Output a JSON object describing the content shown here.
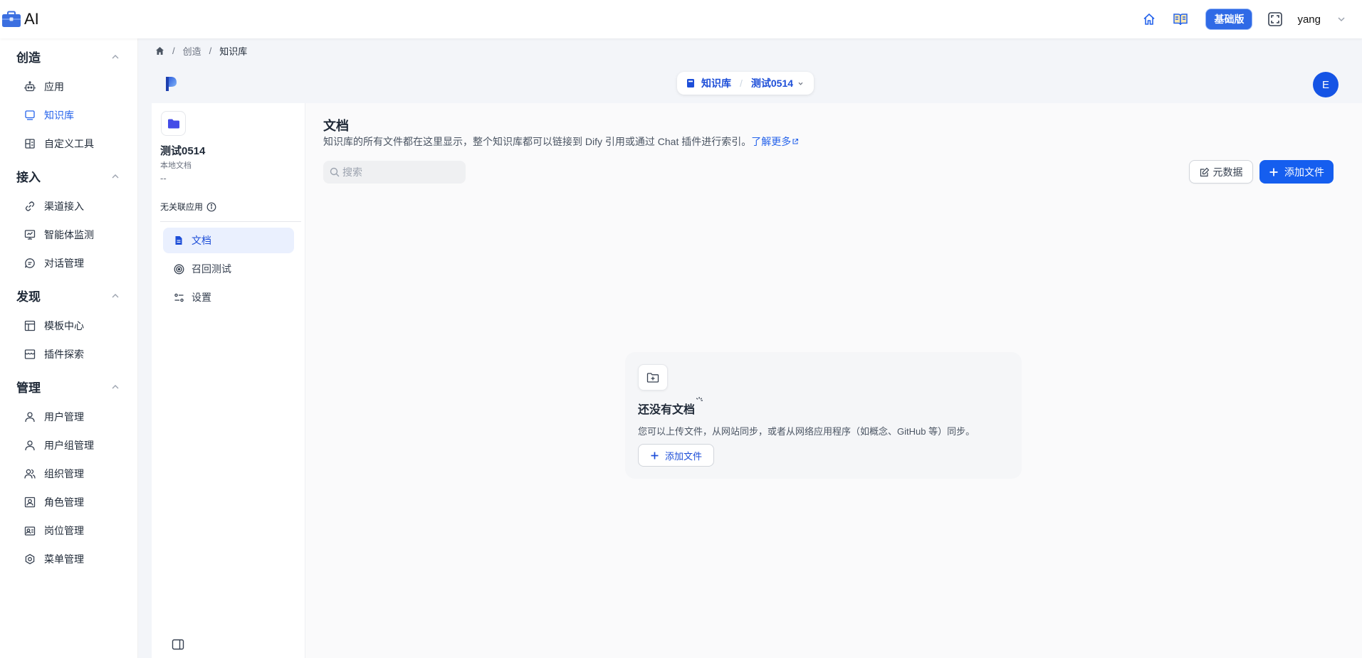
{
  "app": {
    "title": "AI"
  },
  "topbar": {
    "plan_badge": "基础版",
    "user_name": "yang",
    "home_icon": "home-icon",
    "docs_icon": "book-open-icon",
    "fullscreen_icon": "fullscreen-icon"
  },
  "sidebar": {
    "groups": [
      {
        "title": "创造",
        "items": [
          {
            "label": "应用",
            "icon": "robot-icon"
          },
          {
            "label": "知识库",
            "icon": "book-icon",
            "active": true
          },
          {
            "label": "自定义工具",
            "icon": "tool-grid-icon"
          }
        ]
      },
      {
        "title": "接入",
        "items": [
          {
            "label": "渠道接入",
            "icon": "link-icon"
          },
          {
            "label": "智能体监测",
            "icon": "monitor-icon"
          },
          {
            "label": "对话管理",
            "icon": "chat-icon"
          }
        ]
      },
      {
        "title": "发现",
        "items": [
          {
            "label": "模板中心",
            "icon": "layout-icon"
          },
          {
            "label": "插件探索",
            "icon": "store-icon"
          }
        ]
      },
      {
        "title": "管理",
        "items": [
          {
            "label": "用户管理",
            "icon": "user-icon"
          },
          {
            "label": "用户组管理",
            "icon": "user-icon"
          },
          {
            "label": "组织管理",
            "icon": "users-icon"
          },
          {
            "label": "角色管理",
            "icon": "id-card-icon"
          },
          {
            "label": "岗位管理",
            "icon": "badge-icon"
          },
          {
            "label": "菜单管理",
            "icon": "gear-icon"
          }
        ]
      }
    ]
  },
  "breadcrumb": {
    "items": [
      "创造",
      "知识库"
    ]
  },
  "header": {
    "pill_section": "知识库",
    "pill_dataset": "测试0514",
    "avatar_initial": "E"
  },
  "kb": {
    "name": "测试0514",
    "type": "本地文档",
    "description": "--",
    "no_app": "无关联应用",
    "nav": [
      {
        "label": "文档",
        "active": true
      },
      {
        "label": "召回测试"
      },
      {
        "label": "设置"
      }
    ]
  },
  "documents": {
    "title": "文档",
    "description": "知识库的所有文件都在这里显示，整个知识库都可以链接到 Dify 引用或通过 Chat 插件进行索引。",
    "learn_more": "了解更多",
    "search_placeholder": "搜索",
    "metadata_button": "元数据",
    "add_button": "添加文件",
    "empty": {
      "title": "还没有文档",
      "description": "您可以上传文件，从网站同步，或者从网络应用程序（如概念、GitHub 等）同步。",
      "add_button": "添加文件"
    }
  },
  "colors": {
    "primary": "#155eef",
    "active_text": "#2563eb",
    "active_bg": "#eaf0fe"
  }
}
